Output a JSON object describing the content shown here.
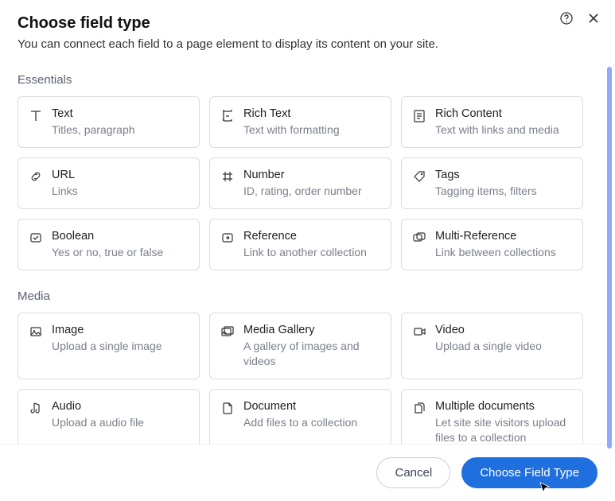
{
  "header": {
    "title": "Choose field type",
    "subtitle": "You can connect each field to a page element to display its content on your site."
  },
  "sections": {
    "essentials": {
      "title": "Essentials",
      "cards": [
        {
          "icon": "text-icon",
          "title": "Text",
          "desc": "Titles, paragraph"
        },
        {
          "icon": "richtext-icon",
          "title": "Rich Text",
          "desc": "Text with formatting"
        },
        {
          "icon": "richcontent-icon",
          "title": "Rich Content",
          "desc": "Text with links and media"
        },
        {
          "icon": "url-icon",
          "title": "URL",
          "desc": "Links"
        },
        {
          "icon": "number-icon",
          "title": "Number",
          "desc": "ID, rating, order number"
        },
        {
          "icon": "tags-icon",
          "title": "Tags",
          "desc": "Tagging items, filters"
        },
        {
          "icon": "boolean-icon",
          "title": "Boolean",
          "desc": "Yes or no, true or false"
        },
        {
          "icon": "reference-icon",
          "title": "Reference",
          "desc": "Link to another collection"
        },
        {
          "icon": "multireference-icon",
          "title": "Multi-Reference",
          "desc": "Link between collections"
        }
      ]
    },
    "media": {
      "title": "Media",
      "cards": [
        {
          "icon": "image-icon",
          "title": "Image",
          "desc": "Upload a single image"
        },
        {
          "icon": "gallery-icon",
          "title": "Media Gallery",
          "desc": "A gallery of images and videos"
        },
        {
          "icon": "video-icon",
          "title": "Video",
          "desc": "Upload a single video"
        },
        {
          "icon": "audio-icon",
          "title": "Audio",
          "desc": "Upload a audio file"
        },
        {
          "icon": "document-icon",
          "title": "Document",
          "desc": "Add files to a collection"
        },
        {
          "icon": "multidoc-icon",
          "title": "Multiple documents",
          "desc": "Let site site visitors upload files to a collection"
        }
      ]
    }
  },
  "footer": {
    "cancel": "Cancel",
    "choose": "Choose Field Type"
  }
}
